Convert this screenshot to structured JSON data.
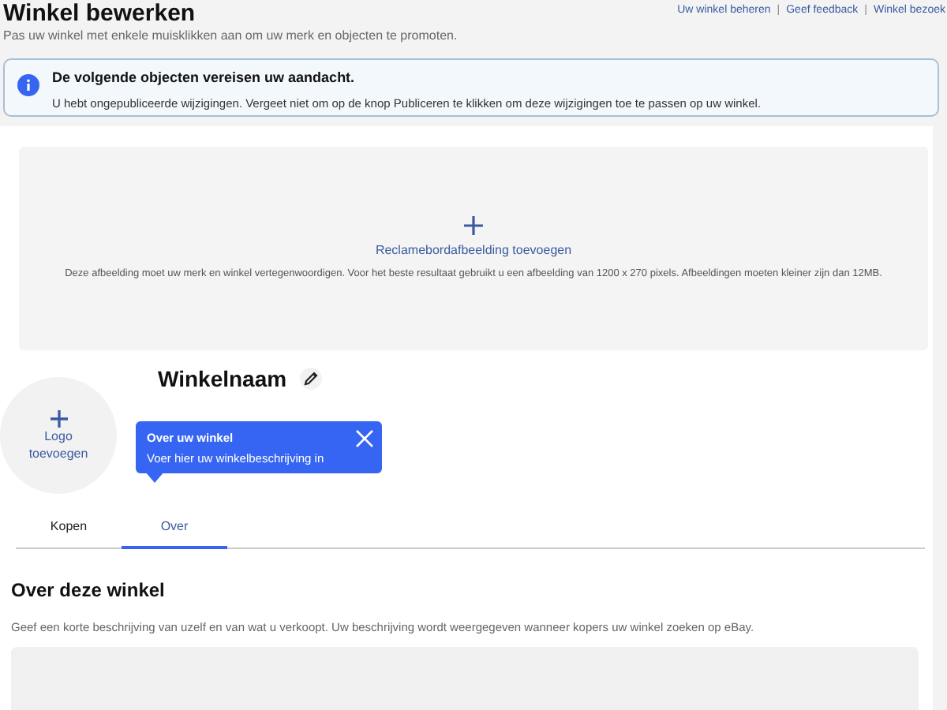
{
  "header": {
    "title": "Winkel bewerken",
    "subtitle": "Pas uw winkel met enkele muisklikken aan om uw merk en objecten te promoten.",
    "links": [
      "Uw winkel beheren",
      "Geef feedback",
      "Winkel bezoek"
    ],
    "link_separator": "|"
  },
  "alert": {
    "title": "De volgende objecten vereisen uw aandacht.",
    "message": "U hebt ongepubliceerde wijzigingen. Vergeet niet om op de knop Publiceren te klikken om deze wijzigingen toe te passen op uw winkel."
  },
  "billboard": {
    "action": "Reclamebordafbeelding toevoegen",
    "hint": "Deze afbeelding moet uw merk en winkel vertegenwoordigen. Voor het beste resultaat gebruikt u een afbeelding van 1200 x 270 pixels. Afbeeldingen moeten kleiner zijn dan 12MB."
  },
  "logo": {
    "action": "Logo toevoegen"
  },
  "store_name": "Winkelnaam",
  "tooltip": {
    "title": "Over uw winkel",
    "message": "Voer hier uw winkelbeschrijving in"
  },
  "tabs": [
    {
      "label": "Kopen",
      "selected": false
    },
    {
      "label": "Over",
      "selected": true
    }
  ],
  "about": {
    "heading": "Over deze winkel",
    "description": "Geef een korte beschrijving van uzelf en van wat u verkoopt. Uw beschrijving wordt weergegeven wanneer kopers uw winkel zoeken op eBay."
  }
}
